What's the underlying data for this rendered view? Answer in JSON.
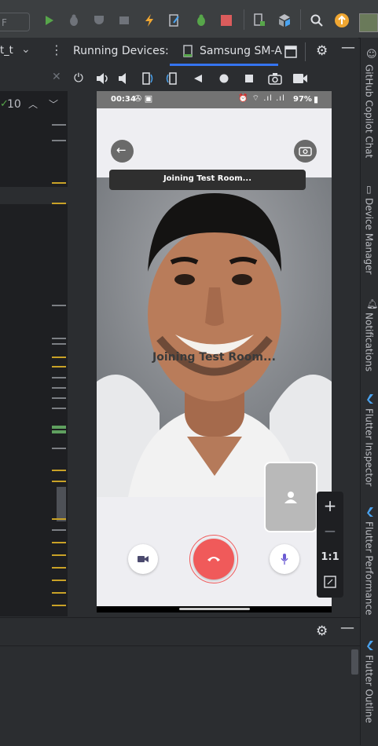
{
  "toolbar": {
    "config_combo": "F",
    "run_label": "Run",
    "device_tab_file": "t_t"
  },
  "left": {
    "problems_count": "10"
  },
  "running_devices": {
    "title": "Running Devices:",
    "device_tab": "Samsung SM-A"
  },
  "phone": {
    "status_time": "00:34",
    "battery": "97%",
    "banner": "Joining Test Room...",
    "overlay": "Joining Test Room..."
  },
  "zoom": {
    "plus": "+",
    "minus": "−",
    "one_to_one": "1:1"
  },
  "right_tabs": [
    "GitHub Copilot Chat",
    "Device Manager",
    "Notifications",
    "Flutter Inspector",
    "Flutter Performance",
    "Flutter Outline"
  ],
  "colors": {
    "accent": "#3574f0",
    "hangup": "#f05a5a",
    "warning": "#c9a227"
  }
}
